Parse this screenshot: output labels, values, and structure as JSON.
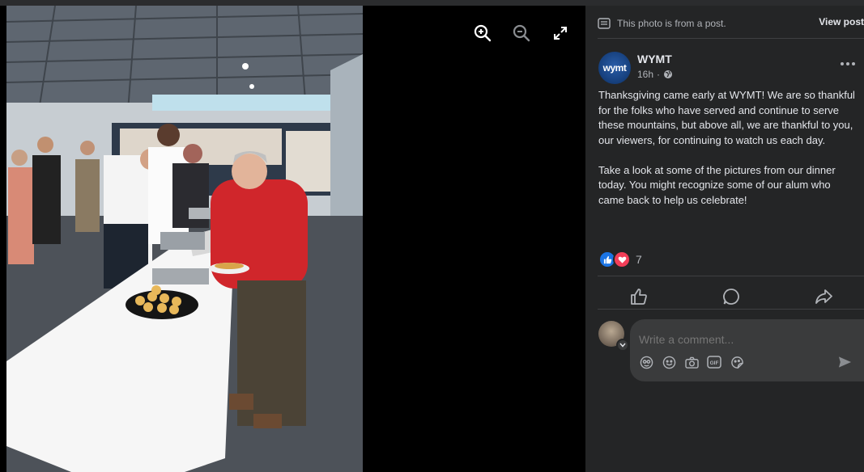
{
  "viewer": {
    "icons": [
      "zoom-in-icon",
      "zoom-out-icon",
      "fullscreen-icon"
    ]
  },
  "post": {
    "note": "This photo is from a post.",
    "view_post": "View post",
    "page_name": "WYMT",
    "page_logo_text": "wymt",
    "time": "16h",
    "audience_icon": "globe-icon",
    "paragraphs": [
      "Thanksgiving came early at WYMT! We are so thankful for the folks who have served and continue to serve these mountains, but above all, we are thankful to you, our viewers, for continuing to watch us each day.",
      "Take a look at some of the pictures from our dinner today. You might recognize some of our alum who came back to help us celebrate!"
    ],
    "reaction_count": "7",
    "reactions": [
      "like",
      "love"
    ],
    "actions": [
      "like-icon",
      "comment-icon",
      "share-icon"
    ]
  },
  "comment": {
    "placeholder": "Write a comment...",
    "tools": [
      "avatar-sticker-icon",
      "emoji-icon",
      "camera-icon",
      "gif-icon",
      "sticker-icon"
    ],
    "send_icon": "send-icon"
  },
  "colors": {
    "panel_bg": "#242526",
    "input_bg": "#3a3b3c",
    "text_primary": "#e4e6eb",
    "text_secondary": "#b0b3b8",
    "like_blue": "#1b74e4",
    "love_red": "#f33e58"
  }
}
